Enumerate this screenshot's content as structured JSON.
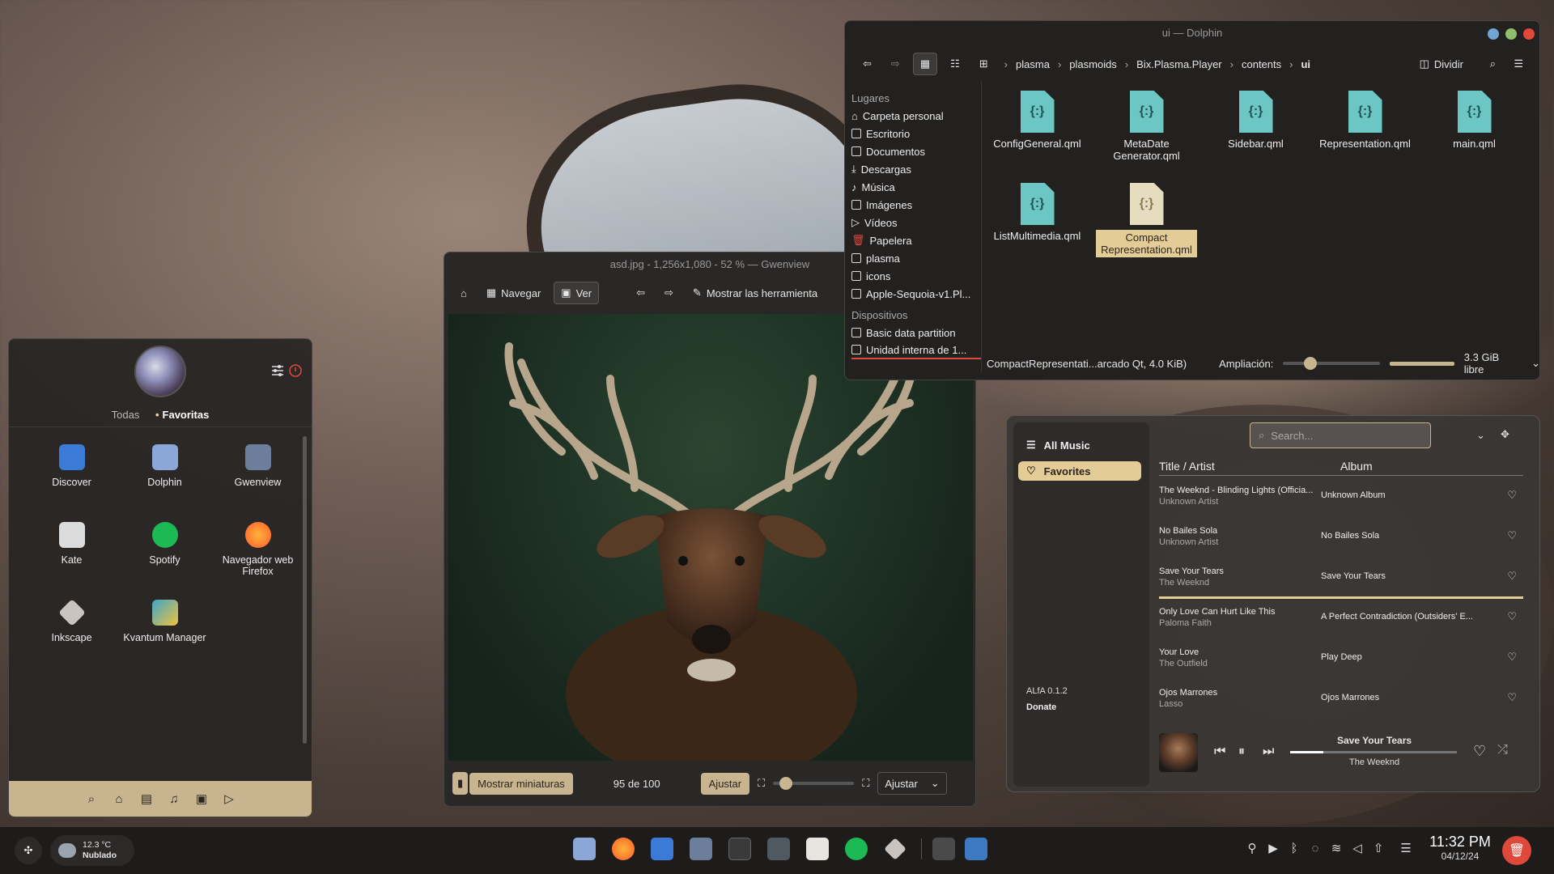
{
  "launcher": {
    "tabs": [
      "Todas",
      "Favoritas"
    ],
    "active_tab": "Favoritas",
    "apps": [
      {
        "name": "Discover",
        "color": "#3b7ad6"
      },
      {
        "name": "Dolphin",
        "color": "#8aa7d8"
      },
      {
        "name": "Gwenview",
        "color": "#6b7f9c"
      },
      {
        "name": "Kate",
        "color": "#dcdcdc"
      },
      {
        "name": "Spotify",
        "color": "#1db954"
      },
      {
        "name": "Navegador web Firefox",
        "color": "#ff7139"
      },
      {
        "name": "Inkscape",
        "color": "#c9c4bf"
      },
      {
        "name": "Kvantum Manager",
        "color": "#3fa7c7"
      }
    ],
    "bottom_icons": [
      "search-icon",
      "home-icon",
      "document-icon",
      "music-icon",
      "image-icon",
      "play-icon"
    ]
  },
  "gwenview": {
    "title": "asd.jpg - 1,256x1,080 - 52 % — Gwenview",
    "navigate_label": "Navegar",
    "view_label": "Ver",
    "tools_label": "Mostrar las herramienta",
    "thumbnails_label": "Mostrar miniaturas",
    "counter": "95 de 100",
    "fit_label": "Ajustar",
    "zoom_combo": "Ajustar"
  },
  "dolphin": {
    "title": "ui — Dolphin",
    "breadcrumb": [
      "plasma",
      "plasmoids",
      "Bix.Plasma.Player",
      "contents",
      "ui"
    ],
    "split_label": "Dividir",
    "places_header": "Lugares",
    "places": [
      "Carpeta personal",
      "Escritorio",
      "Documentos",
      "Descargas",
      "Música",
      "Imágenes",
      "Vídeos",
      "Papelera",
      "plasma",
      "icons",
      "Apple-Sequoia-v1.Pl..."
    ],
    "devices_header": "Dispositivos",
    "devices": [
      "Basic data partition",
      "Unidad interna de 1..."
    ],
    "files": [
      {
        "name": "ConfigGeneral.qml"
      },
      {
        "name": "MetaDate Generator.qml"
      },
      {
        "name": "Sidebar.qml"
      },
      {
        "name": "Representation.qml"
      },
      {
        "name": "main.qml"
      },
      {
        "name": "ListMultimedia.qml"
      },
      {
        "name": "Compact Representation.qml",
        "selected": true
      }
    ],
    "status_file": "CompactRepresentati...arcado Qt, 4.0 KiB)",
    "zoom_label": "Ampliación:",
    "free_space": "3.3 GiB libre"
  },
  "player": {
    "all_music": "All Music",
    "favorites": "Favorites",
    "search_placeholder": "Search...",
    "col_title": "Title / Artist",
    "col_album": "Album",
    "tracks": [
      {
        "title": "The Weeknd - Blinding Lights (Officia...",
        "artist": "Unknown Artist",
        "album": "Unknown Album"
      },
      {
        "title": "No Bailes Sola",
        "artist": "Unknown Artist",
        "album": "No Bailes Sola"
      },
      {
        "title": "Save Your Tears",
        "artist": "The Weeknd",
        "album": "Save Your Tears"
      },
      {
        "title": "Only Love Can Hurt Like This",
        "artist": "Paloma Faith",
        "album": "A Perfect Contradiction (Outsiders' E..."
      },
      {
        "title": "Your Love",
        "artist": "The Outfield",
        "album": "Play Deep"
      },
      {
        "title": "Ojos Marrones",
        "artist": "Lasso",
        "album": "Ojos Marrones"
      }
    ],
    "version": "ALfA 0.1.2",
    "donate": "Donate",
    "now_playing_title": "Save Your Tears",
    "now_playing_artist": "The Weeknd",
    "progress": 0.2
  },
  "taskbar": {
    "temperature": "12.3 °C",
    "weather": "Nublado",
    "time": "11:32 PM",
    "date": "04/12/24",
    "trash_color": "#e0483c"
  }
}
